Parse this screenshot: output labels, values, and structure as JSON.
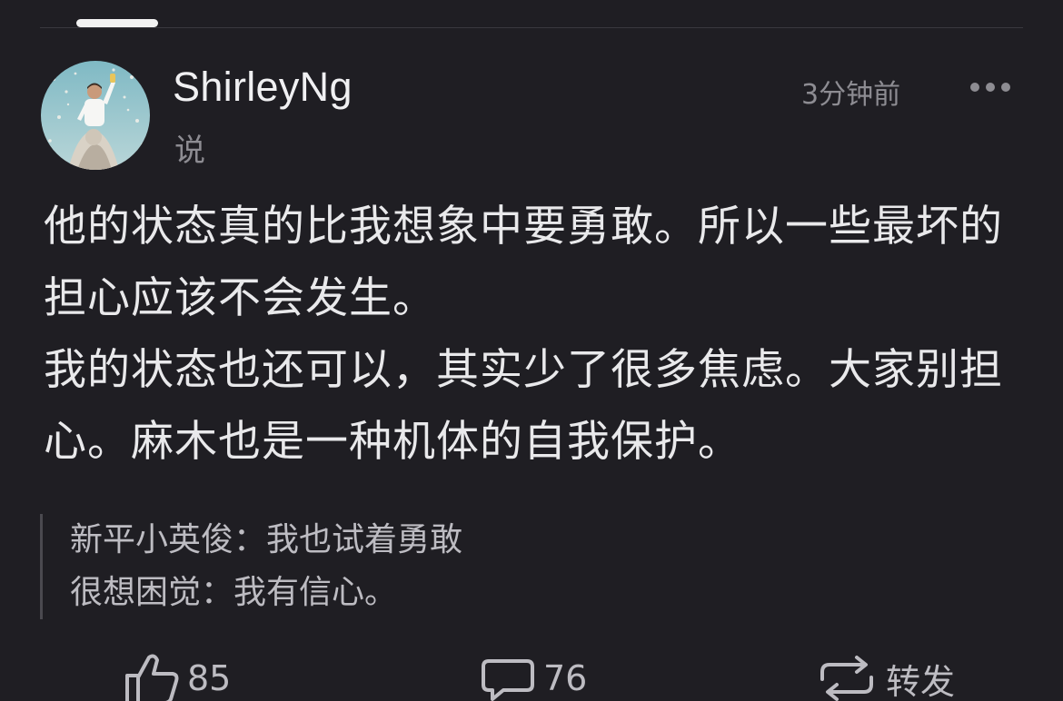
{
  "post": {
    "author": "ShirleyNg",
    "verb": "说",
    "time": "3分钟前",
    "more_icon": "more-dots-icon",
    "body": [
      "他的状态真的比我想象中要勇敢。所以一些最坏的担心应该不会发生。",
      "我的状态也还可以，其实少了很多焦虑。大家别担心。麻木也是一种机体的自我保护。"
    ]
  },
  "comments": [
    {
      "author": "新平小英俊",
      "sep": "：",
      "text": "我也试着勇敢"
    },
    {
      "author": "很想困觉",
      "sep": "：",
      "text": "我有信心。"
    }
  ],
  "actions": {
    "like": {
      "icon": "thumbs-up-icon",
      "count": "85"
    },
    "comment": {
      "icon": "comment-bubble-icon",
      "count": "76"
    },
    "repost": {
      "icon": "repost-icon",
      "label": "转发"
    }
  },
  "colors": {
    "background": "#1f1e23",
    "primary_text": "#e9e9eb",
    "secondary_text": "#8d8c92"
  }
}
